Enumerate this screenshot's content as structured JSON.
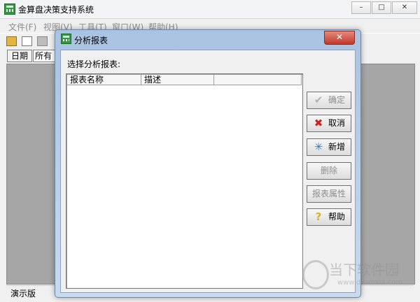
{
  "main": {
    "title": "金算盘决策支持系统",
    "controls": {
      "minimize": "–",
      "maximize": "□",
      "close": "✕"
    },
    "menu": [
      "文件(F)",
      "视图(V)",
      "工具(T)",
      "窗口(W)",
      "帮助(H)"
    ],
    "filter": {
      "label": "日期",
      "value": "所有"
    },
    "status": "演示版"
  },
  "dialog": {
    "title": "分析报表",
    "close": "✕",
    "prompt": "选择分析报表:",
    "columns": [
      "报表名称",
      "描述"
    ],
    "buttons": {
      "ok": "确定",
      "cancel": "取消",
      "new": "新增",
      "delete": "删除",
      "properties": "报表属性",
      "help": "帮助"
    },
    "icons": {
      "ok": "✔",
      "cancel": "✖",
      "new": "✳",
      "help": "?"
    }
  },
  "watermark": {
    "text": "当下软件园",
    "url": "www.downxia.com"
  }
}
